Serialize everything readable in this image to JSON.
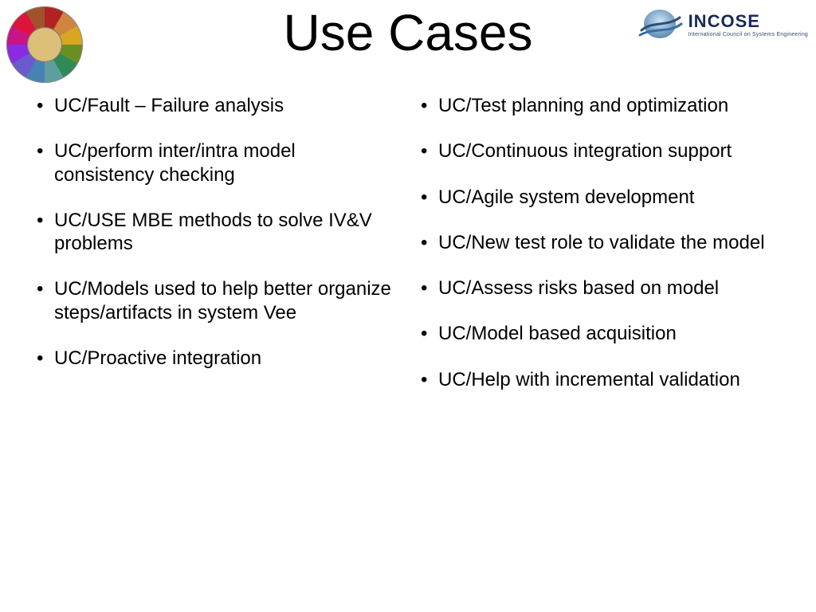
{
  "header": {
    "title": "Use Cases",
    "left_logo_name": "mbse-color-wheel",
    "right_logo": {
      "brand": "INCOSE",
      "tagline": "International Council on Systems Engineering"
    }
  },
  "columns": {
    "left": [
      "UC/Fault – Failure analysis",
      "UC/perform inter/intra model consistency checking",
      "UC/USE MBE methods to solve IV&V problems",
      "UC/Models used to help better organize steps/artifacts in system Vee",
      "UC/Proactive integration"
    ],
    "right": [
      "UC/Test planning and optimization",
      "UC/Continuous integration support",
      "UC/Agile system development",
      "UC/New test role to validate the model",
      "UC/Assess risks based on model",
      "UC/Model based acquisition",
      "UC/Help with incremental validation"
    ]
  }
}
